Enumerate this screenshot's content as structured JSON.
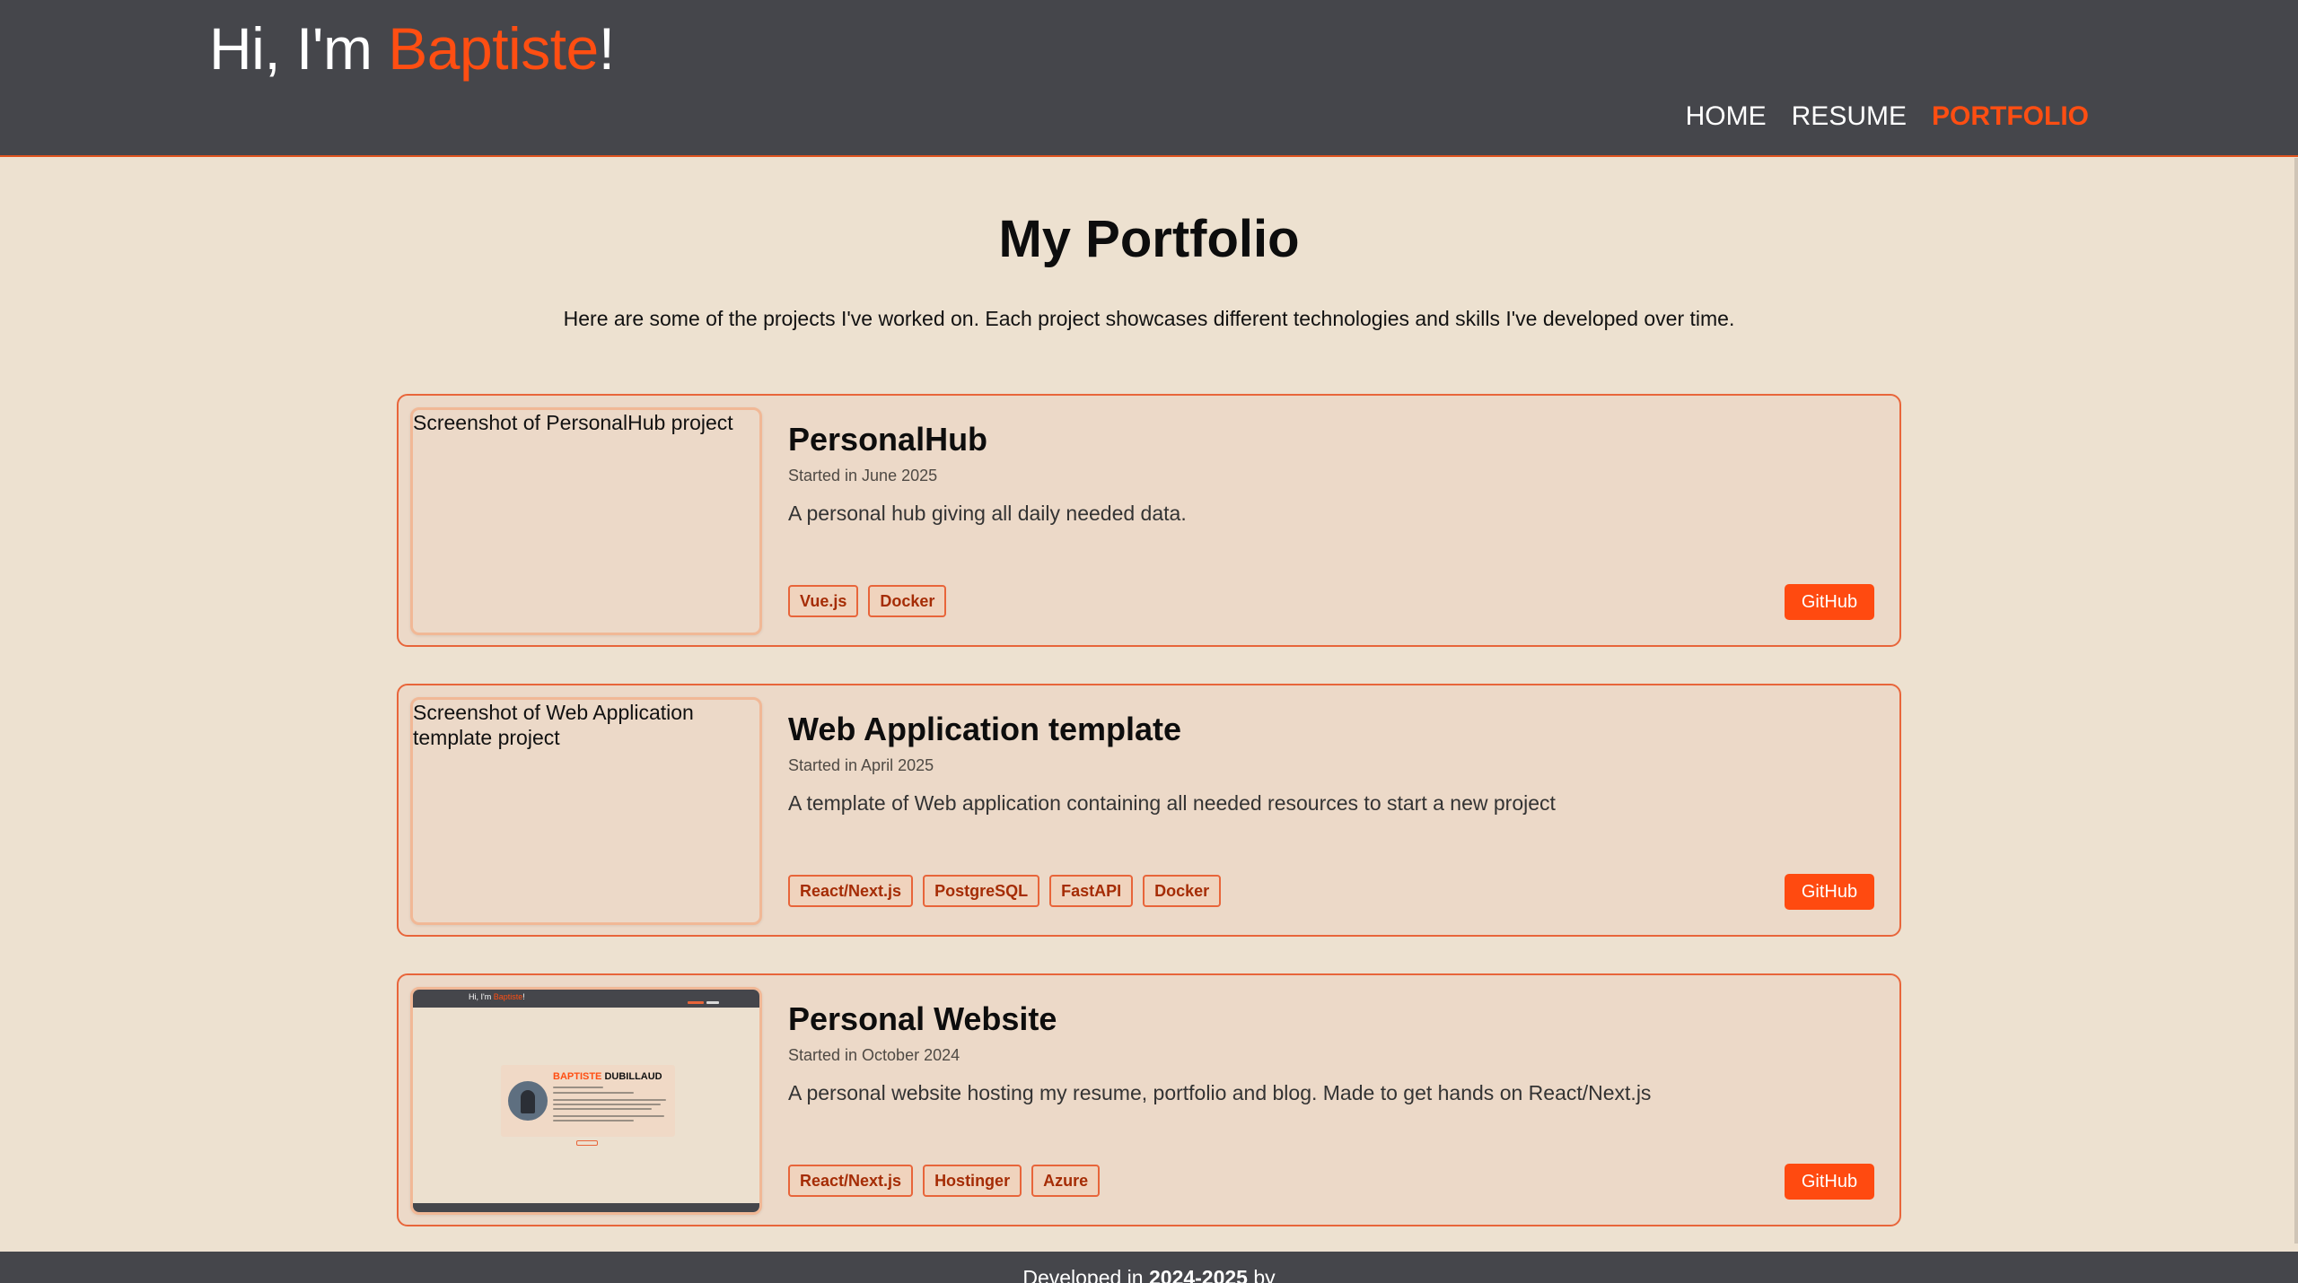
{
  "header": {
    "greeting": "Hi, I'm ",
    "name": "Baptiste",
    "exclamation": "!",
    "nav": [
      {
        "label": "HOME",
        "active": false
      },
      {
        "label": "RESUME",
        "active": false
      },
      {
        "label": "PORTFOLIO",
        "active": true
      }
    ]
  },
  "main": {
    "title": "My Portfolio",
    "intro": "Here are some of the projects I've worked on. Each project showcases different technologies and skills I've developed over time.",
    "projects": [
      {
        "thumb_alt": "Screenshot of PersonalHub project",
        "title": "PersonalHub",
        "date": "Started in June 2025",
        "description": "A personal hub giving all daily needed data.",
        "tags": [
          "Vue.js",
          "Docker"
        ],
        "button": "GitHub"
      },
      {
        "thumb_alt": "Screenshot of Web Application template project",
        "title": "Web Application template",
        "date": "Started in April 2025",
        "description": "A template of Web application containing all needed resources to start a new project",
        "tags": [
          "React/Next.js",
          "PostgreSQL",
          "FastAPI",
          "Docker"
        ],
        "button": "GitHub"
      },
      {
        "thumb_alt": "",
        "title": "Personal Website",
        "date": "Started in October 2024",
        "description": "A personal website hosting my resume, portfolio and blog. Made to get hands on React/Next.js",
        "tags": [
          "React/Next.js",
          "Hostinger",
          "Azure"
        ],
        "button": "GitHub",
        "thumb_preview": {
          "brand_greeting": "Hi, I'm ",
          "brand_name": "Baptiste",
          "brand_exclamation": "!",
          "card_first": "BAPTISTE",
          "card_last": " DUBILLAUD"
        }
      }
    ]
  },
  "footer": {
    "prefix": "Developed in ",
    "years": "2024-2025",
    "suffix": " by"
  },
  "colors": {
    "accent": "#ff4e12",
    "header_bg": "#45464b",
    "page_bg": "#ede1d0"
  }
}
